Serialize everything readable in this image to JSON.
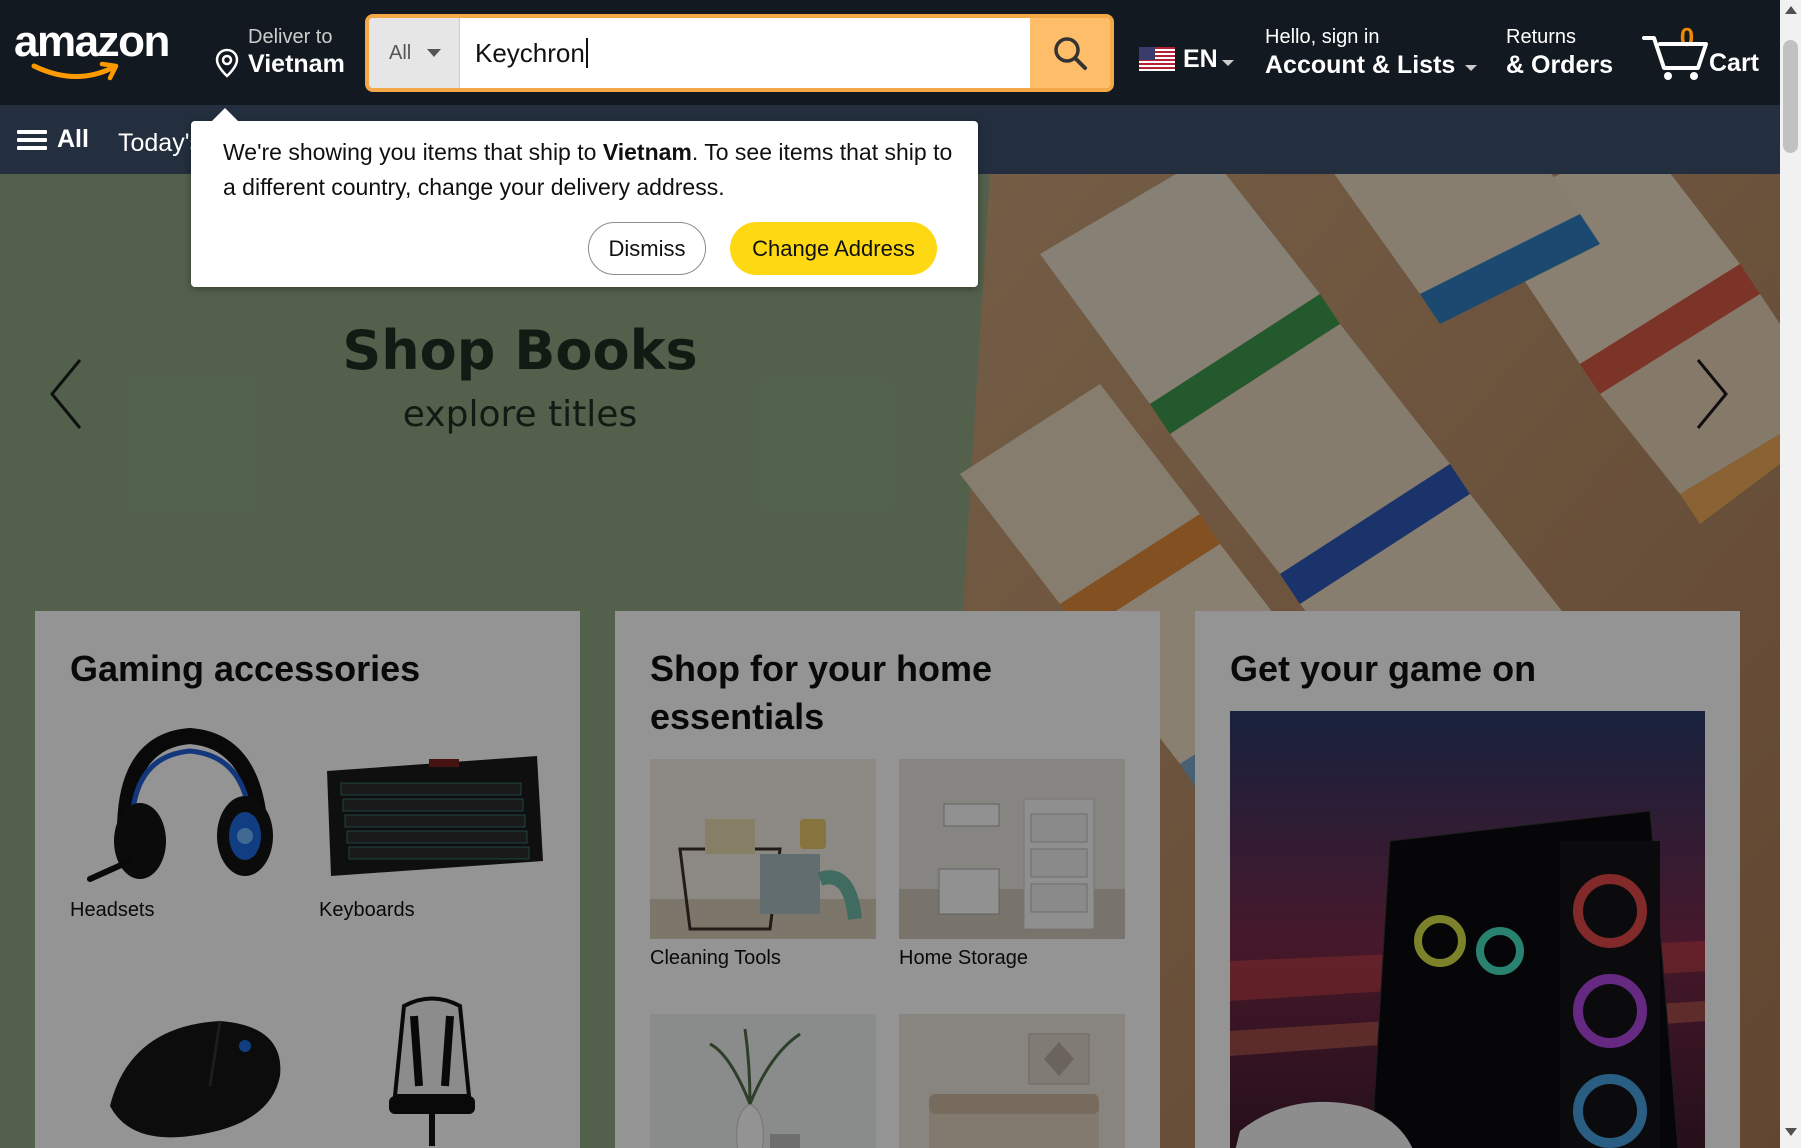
{
  "header": {
    "logo_text": "amazon",
    "deliver": {
      "line1": "Deliver to",
      "line2": "Vietnam"
    },
    "search": {
      "category": "All",
      "value": "Keychron"
    },
    "language": "EN",
    "account": {
      "line1": "Hello, sign in",
      "line2": "Account & Lists"
    },
    "returns": {
      "line1": "Returns",
      "line2": "& Orders"
    },
    "cart": {
      "count": "0",
      "label": "Cart"
    }
  },
  "subnav": {
    "all_label": "All",
    "items": [
      "Today's Deals"
    ]
  },
  "popover": {
    "msg_before": "We're showing you items that ship to ",
    "msg_country": "Vietnam",
    "msg_after": ". To see items that ship to a different country, change your delivery address.",
    "dismiss": "Dismiss",
    "change": "Change Address"
  },
  "hero": {
    "title": "Shop Books",
    "subtitle": "explore titles"
  },
  "cards": [
    {
      "title": "Gaming accessories",
      "tiles": [
        {
          "caption": "Headsets",
          "icon": "headset-image"
        },
        {
          "caption": "Keyboards",
          "icon": "keyboard-image"
        },
        {
          "caption": "",
          "icon": "mouse-image"
        },
        {
          "caption": "",
          "icon": "gaming-chair-image"
        }
      ]
    },
    {
      "title": "Shop for your home essentials",
      "tiles": [
        {
          "caption": "Cleaning Tools",
          "icon": "cleaning-tools-image"
        },
        {
          "caption": "Home Storage",
          "icon": "home-storage-image"
        },
        {
          "caption": "",
          "icon": "home-decor-image"
        },
        {
          "caption": "",
          "icon": "bedding-image"
        }
      ]
    },
    {
      "title": "Get your game on",
      "image": "gaming-pc-image"
    }
  ],
  "colors": {
    "nav_top": "#131921",
    "nav_sub": "#232f3e",
    "search_border": "#f3a847",
    "search_button": "#febd69",
    "cart_count": "#f08804",
    "change_button": "#ffd814"
  }
}
